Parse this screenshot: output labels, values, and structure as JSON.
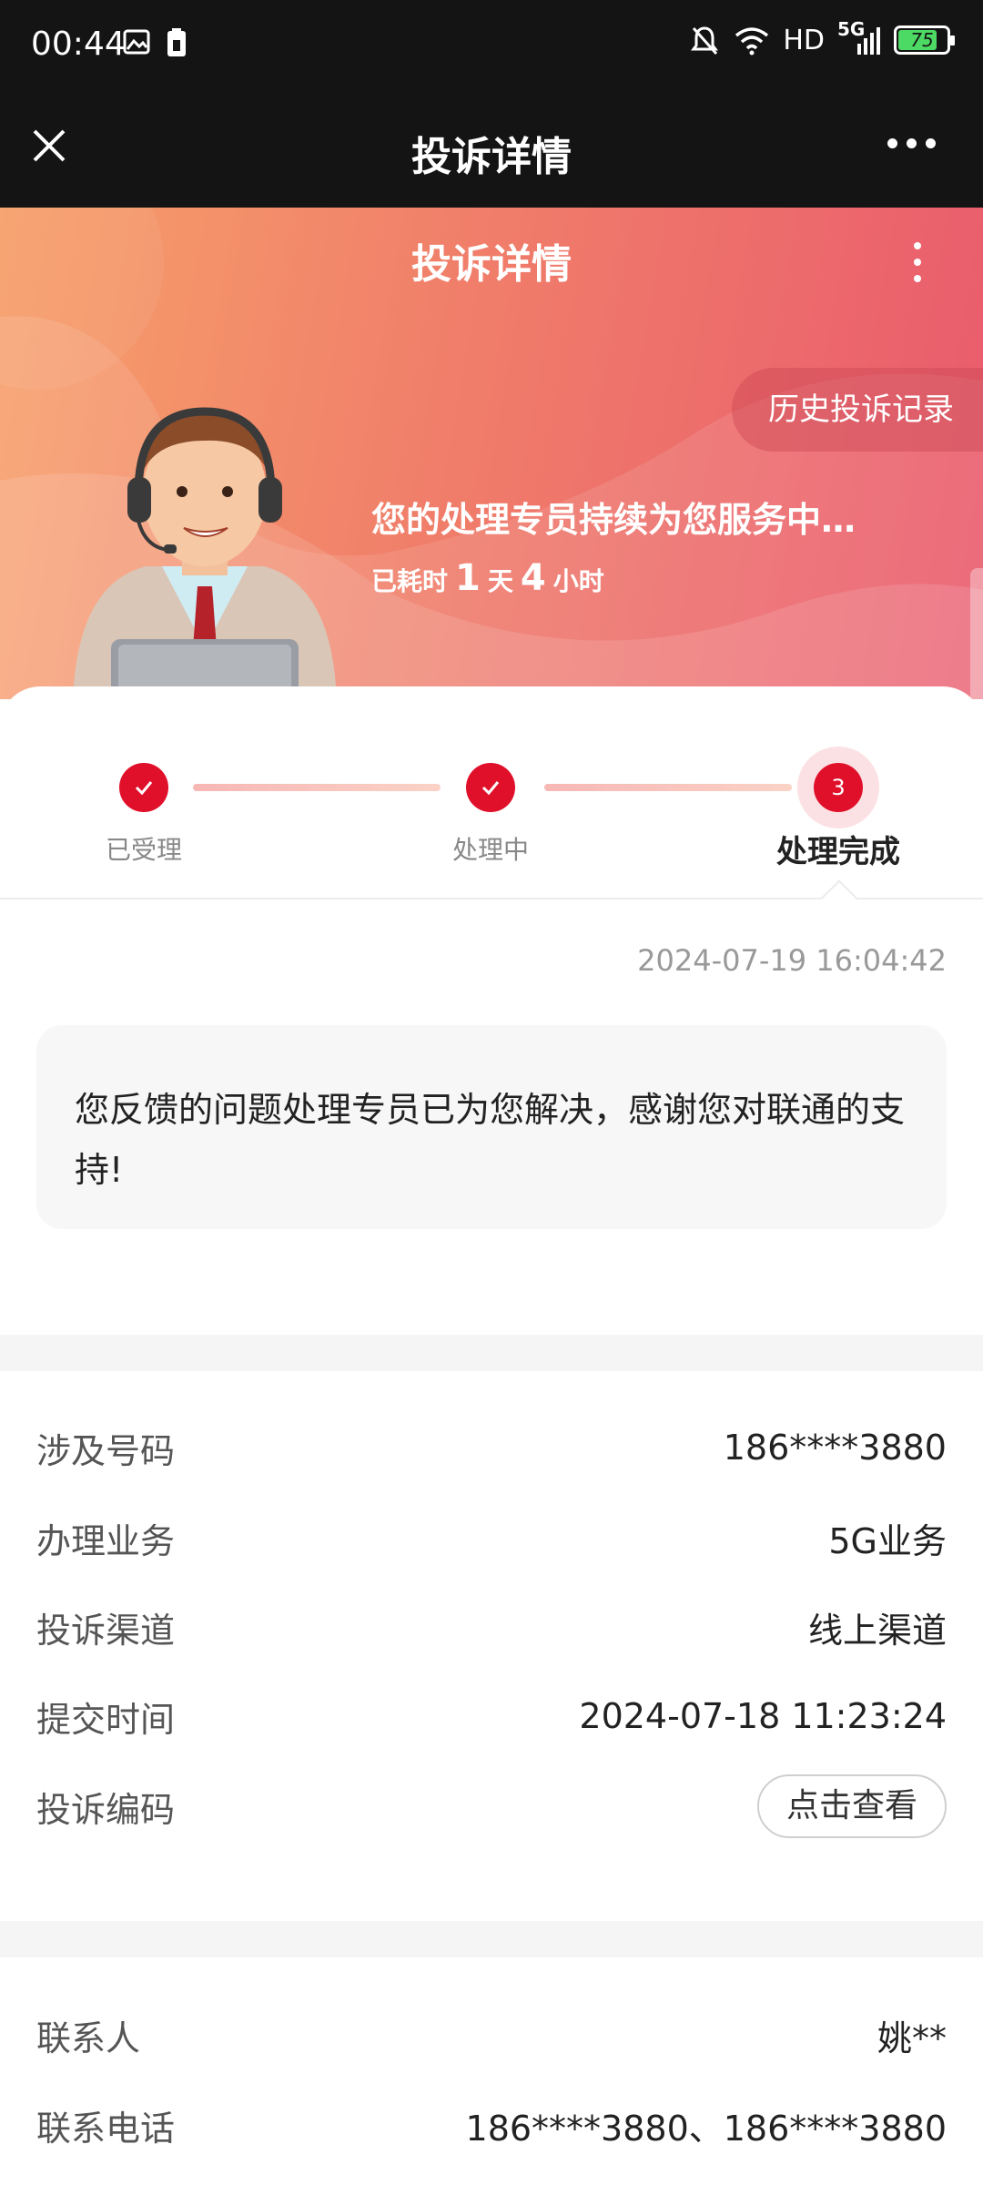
{
  "status_bar": {
    "time": "00:44",
    "network": "HD",
    "signal": "5G",
    "battery": "75"
  },
  "nav": {
    "title": "投诉详情"
  },
  "hero": {
    "title": "投诉详情",
    "history_button": "历史投诉记录",
    "message": "您的处理专员持续为您服务中…",
    "elapsed_prefix": "已耗时",
    "elapsed_days": "1",
    "elapsed_day_unit": "天",
    "elapsed_hours": "4",
    "elapsed_hour_unit": "小时"
  },
  "steps": [
    {
      "label": "已受理",
      "state": "done"
    },
    {
      "label": "处理中",
      "state": "done"
    },
    {
      "label": "处理完成",
      "state": "active",
      "number": "3"
    }
  ],
  "result": {
    "timestamp": "2024-07-19 16:04:42",
    "message": "您反馈的问题处理专员已为您解决，感谢您对联通的支持!"
  },
  "details": {
    "number_label": "涉及号码",
    "number_value": "186****3880",
    "service_label": "办理业务",
    "service_value": "5G业务",
    "channel_label": "投诉渠道",
    "channel_value": "线上渠道",
    "submit_label": "提交时间",
    "submit_value": "2024-07-18 11:23:24",
    "code_label": "投诉编码",
    "code_button": "点击查看"
  },
  "contact": {
    "name_label": "联系人",
    "name_value": "姚**",
    "phone_label": "联系电话",
    "phone_value": "186****3880、186****3880"
  },
  "colors": {
    "accent": "#e0102b",
    "hero_start": "#f7a06b",
    "hero_end": "#e95a6d",
    "bar": "#141414"
  }
}
